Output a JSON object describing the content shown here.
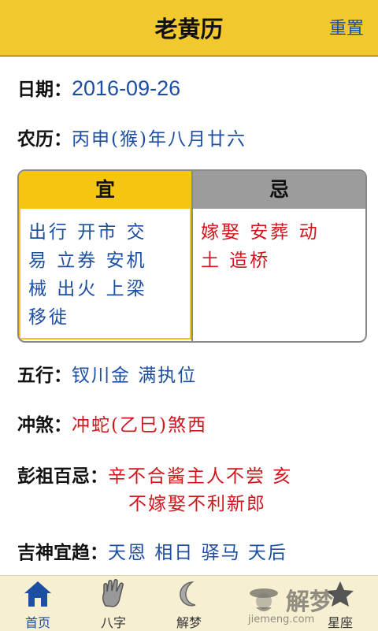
{
  "header": {
    "title": "老黄历",
    "reset_label": "重置"
  },
  "date": {
    "label": "日期：",
    "value": "2016-09-26"
  },
  "lunar": {
    "label": "农历：",
    "value": "丙申(猴)年八月廿六"
  },
  "yiji": {
    "yi_label": "宜",
    "ji_label": "忌",
    "yi_lines": [
      "出行 开市 交",
      "易 立券 安机",
      "械 出火 上梁",
      "移徙"
    ],
    "ji_lines": [
      "嫁娶 安葬 动",
      "土 造桥"
    ]
  },
  "wuxing": {
    "label": "五行：",
    "value": "钗川金 满执位"
  },
  "chongsha": {
    "label": "冲煞：",
    "value": "冲蛇(乙巳)煞西"
  },
  "pengzu": {
    "label": "彭祖百忌：",
    "line1": "辛不合酱主人不尝 亥",
    "line2": "不嫁娶不利新郎"
  },
  "jishen": {
    "label": "吉神宜趋：",
    "value": "天恩 相日 驿马 天后"
  },
  "tabs": [
    {
      "label": "首页",
      "icon": "home-icon",
      "active": true
    },
    {
      "label": "八字",
      "icon": "palm-icon"
    },
    {
      "label": "解梦",
      "icon": "moon-icon"
    },
    {
      "label": "星座",
      "icon": "star-icon"
    }
  ],
  "watermark": {
    "brand": "解梦",
    "url": "jiemeng.com"
  },
  "colors": {
    "header": "#f1c82e",
    "blue_text": "#1c4ea2",
    "red_text": "#d0161c",
    "yi_yellow": "#f5c611",
    "ji_gray": "#9c9c9c"
  }
}
